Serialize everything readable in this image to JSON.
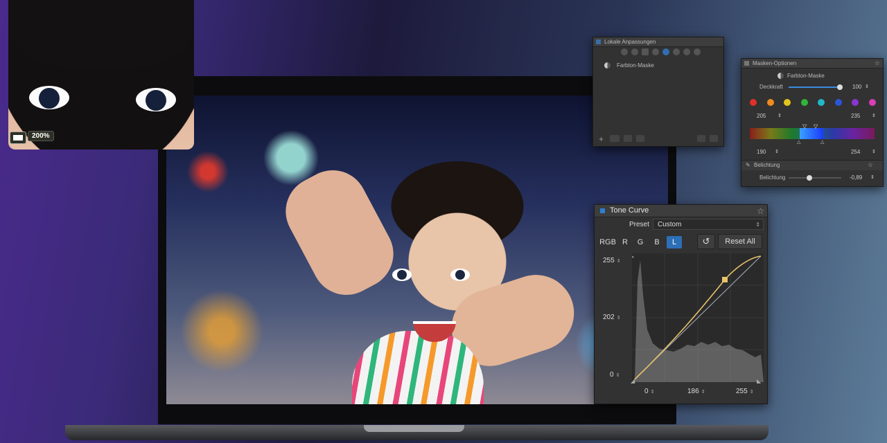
{
  "zoom_inset": {
    "zoom_level": "200%"
  },
  "local_adjustments": {
    "title": "Lokale Anpassungen",
    "mask_item": "Farbton-Maske"
  },
  "mask_options": {
    "title": "Masken-Optionen",
    "mask_name": "Farbton-Maske",
    "opacity_label": "Deckkraft",
    "opacity_value": "100",
    "opacity_level": 1.0,
    "hue_swatch_colors": [
      "#e0302a",
      "#ee8a1f",
      "#e3c51e",
      "#2fb63a",
      "#21b8c8",
      "#2b55d8",
      "#8b34d1",
      "#d93fb3"
    ],
    "range_left_top": "205",
    "range_right_top": "235",
    "range_left_bottom": "190",
    "range_right_bottom": "254",
    "exposure_section": "Belichtung",
    "exposure_label": "Belichtung",
    "exposure_value": "-0,89"
  },
  "tone_curve": {
    "title": "Tone Curve",
    "preset_label": "Preset",
    "preset_value": "Custom",
    "channels": [
      "RGB",
      "R",
      "G",
      "B",
      "L"
    ],
    "selected_channel": "L",
    "reset_label": "Reset All",
    "y_top": "255",
    "y_mid": "202",
    "y_bottom": "0",
    "x_left": "0",
    "x_mid": "186",
    "x_right": "255",
    "accent_color": "#e8c36a"
  }
}
